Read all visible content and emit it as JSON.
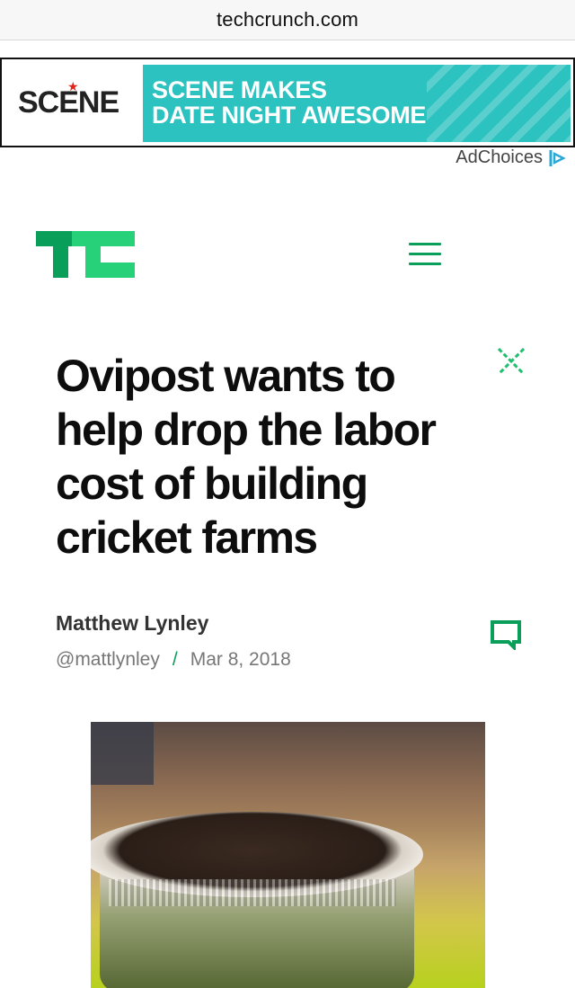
{
  "browser": {
    "url": "techcrunch.com"
  },
  "ad": {
    "brand": "SCENE",
    "headline_line1": "SCENE MAKES",
    "headline_line2": "DATE NIGHT AWESOME",
    "adchoices_label": "AdChoices",
    "colors": {
      "banner": "#2cc2bf",
      "star": "#e2231a"
    }
  },
  "header": {
    "logo_icon": "techcrunch-logo",
    "menu_icon": "hamburger-menu-icon",
    "accent_color": "#0a9e5b"
  },
  "article": {
    "title": "Ovipost wants to help drop the labor cost of building cricket farms",
    "author": "Matthew Lynley",
    "handle": "@mattlynley",
    "separator": "/",
    "date": "Mar 8, 2018",
    "close_icon": "close-icon",
    "comment_icon": "comment-icon",
    "image_icon": "cricket-container-photo"
  }
}
